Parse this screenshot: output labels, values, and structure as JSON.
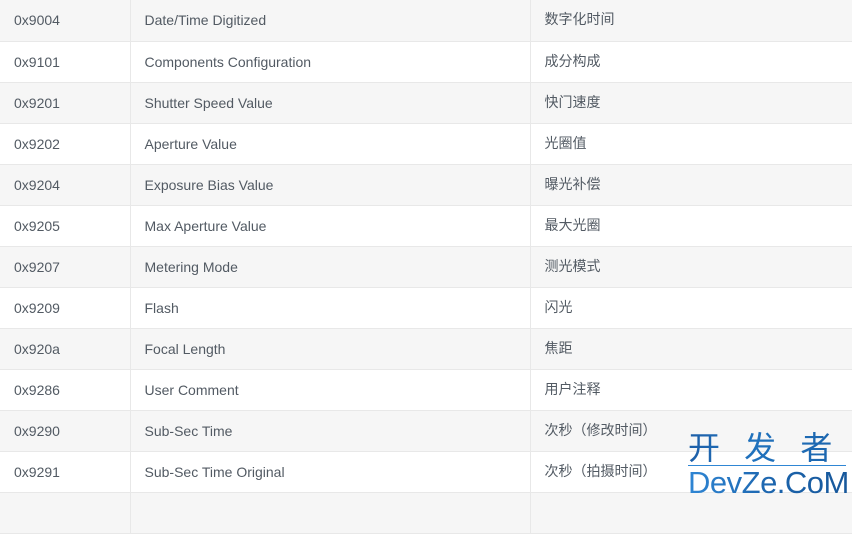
{
  "table": {
    "columns": [
      "tag",
      "name",
      "name_zh"
    ],
    "rows": [
      {
        "tag": "0x9004",
        "name": "Date/Time Digitized",
        "name_zh": "数字化时间"
      },
      {
        "tag": "0x9101",
        "name": "Components Configuration",
        "name_zh": "成分构成"
      },
      {
        "tag": "0x9201",
        "name": "Shutter Speed Value",
        "name_zh": "快门速度"
      },
      {
        "tag": "0x9202",
        "name": "Aperture Value",
        "name_zh": "光圈值"
      },
      {
        "tag": "0x9204",
        "name": "Exposure Bias Value",
        "name_zh": "曝光补偿"
      },
      {
        "tag": "0x9205",
        "name": "Max Aperture Value",
        "name_zh": "最大光圈"
      },
      {
        "tag": "0x9207",
        "name": "Metering Mode",
        "name_zh": "测光模式"
      },
      {
        "tag": "0x9209",
        "name": "Flash",
        "name_zh": "闪光"
      },
      {
        "tag": "0x920a",
        "name": "Focal Length",
        "name_zh": "焦距"
      },
      {
        "tag": "0x9286",
        "name": "User Comment",
        "name_zh": "用户注释"
      },
      {
        "tag": "0x9290",
        "name": "Sub-Sec Time",
        "name_zh": "次秒（修改时间）"
      },
      {
        "tag": "0x9291",
        "name": "Sub-Sec Time Original",
        "name_zh": "次秒（拍摄时间）"
      },
      {
        "tag": "",
        "name": "",
        "name_zh": ""
      }
    ]
  },
  "watermark": {
    "cn": "开 发 者",
    "en": "DevZe.CoM",
    "color": "#1b63ab"
  },
  "colors": {
    "stripe_bg": "#f6f6f6",
    "plain_bg": "#ffffff",
    "border": "#e8e8e8",
    "text": "#525a63"
  }
}
